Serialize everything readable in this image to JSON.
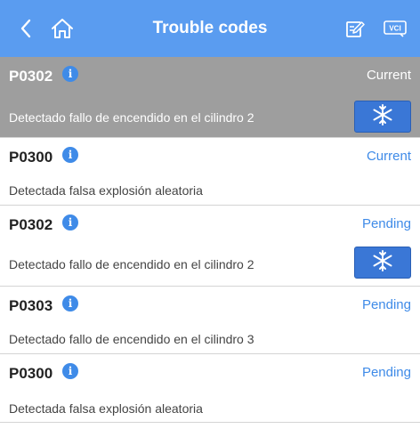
{
  "header": {
    "title": "Trouble codes",
    "vci_label": "VCI",
    "icons": [
      "back-arrow-icon",
      "home-icon",
      "edit-report-icon",
      "vci-icon"
    ]
  },
  "colors": {
    "header_bg": "#5a9cf0",
    "accent": "#3f8be8",
    "selected_row_bg": "#9e9e9e",
    "freeze_button_bg": "#3a77d6"
  },
  "trouble_codes": [
    {
      "code": "P0302",
      "status": "Current",
      "description": "Detectado fallo de encendido en el cilindro 2",
      "has_freeze_frame": true,
      "selected": true
    },
    {
      "code": "P0300",
      "status": "Current",
      "description": "Detectada falsa explosión aleatoria",
      "has_freeze_frame": false,
      "selected": false
    },
    {
      "code": "P0302",
      "status": "Pending",
      "description": "Detectado fallo de encendido en el cilindro 2",
      "has_freeze_frame": true,
      "selected": false
    },
    {
      "code": "P0303",
      "status": "Pending",
      "description": "Detectado fallo de encendido en el cilindro 3",
      "has_freeze_frame": false,
      "selected": false
    },
    {
      "code": "P0300",
      "status": "Pending",
      "description": "Detectada falsa explosión aleatoria",
      "has_freeze_frame": false,
      "selected": false
    }
  ]
}
